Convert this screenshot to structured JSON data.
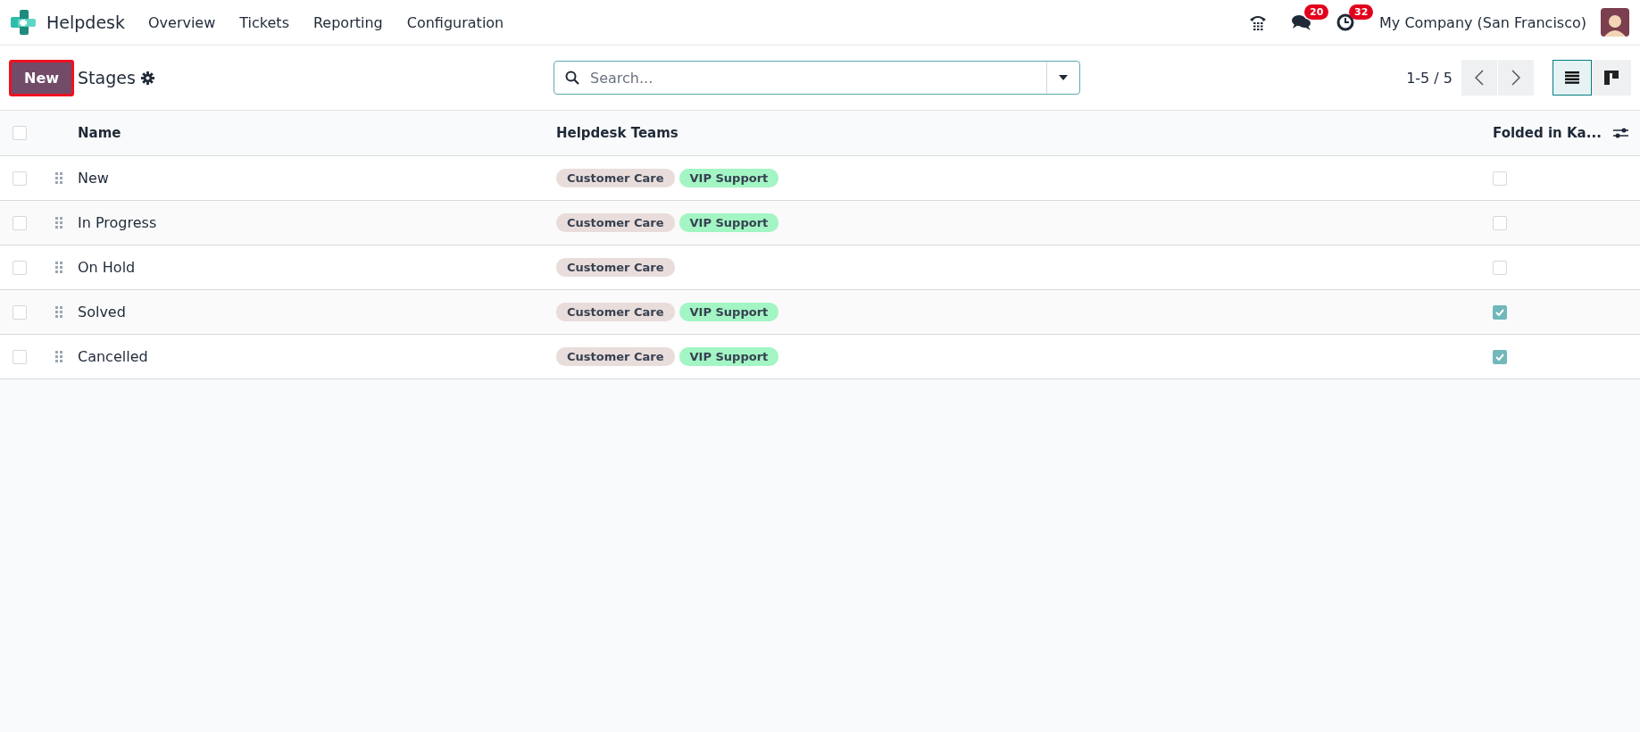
{
  "navbar": {
    "app_name": "Helpdesk",
    "menu": [
      "Overview",
      "Tickets",
      "Reporting",
      "Configuration"
    ],
    "messages_badge": "20",
    "activities_badge": "32",
    "company": "My Company (San Francisco)"
  },
  "control_panel": {
    "new_button": "New",
    "title": "Stages",
    "search": {
      "placeholder": "Search..."
    },
    "pager": "1-5 / 5",
    "views": [
      {
        "kind": "list",
        "selected": true
      },
      {
        "kind": "kanban",
        "selected": false
      }
    ]
  },
  "table": {
    "select_all": {
      "checked": false
    },
    "columns": [
      "Name",
      "Helpdesk Teams",
      "Folded in Ka..."
    ],
    "rows": [
      {
        "name": "New",
        "selected": false,
        "teams": [
          {
            "label": "Customer Care",
            "color": "#e9dddb"
          },
          {
            "label": "VIP Support",
            "color": "#a3f5c4"
          }
        ],
        "folded": false
      },
      {
        "name": "In Progress",
        "selected": false,
        "teams": [
          {
            "label": "Customer Care",
            "color": "#e9dddb"
          },
          {
            "label": "VIP Support",
            "color": "#a3f5c4"
          }
        ],
        "folded": false
      },
      {
        "name": "On Hold",
        "selected": false,
        "teams": [
          {
            "label": "Customer Care",
            "color": "#e9dddb"
          }
        ],
        "folded": false
      },
      {
        "name": "Solved",
        "selected": false,
        "teams": [
          {
            "label": "Customer Care",
            "color": "#e9dddb"
          },
          {
            "label": "VIP Support",
            "color": "#a3f5c4"
          }
        ],
        "folded": true
      },
      {
        "name": "Cancelled",
        "selected": false,
        "teams": [
          {
            "label": "Customer Care",
            "color": "#e9dddb"
          },
          {
            "label": "VIP Support",
            "color": "#a3f5c4"
          }
        ],
        "folded": true
      }
    ]
  }
}
